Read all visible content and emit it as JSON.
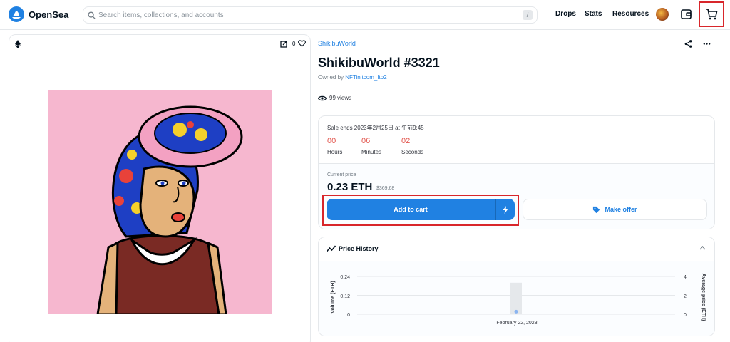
{
  "header": {
    "logo_text": "OpenSea",
    "search_placeholder": "Search items, collections, and accounts",
    "search_shortcut": "/",
    "nav": [
      "Drops",
      "Stats",
      "Resources"
    ]
  },
  "image_panel": {
    "chain_icon": "ethereum-icon",
    "favorite_count": "0"
  },
  "item": {
    "collection": "ShikibuWorld",
    "title": "ShikibuWorld #3321",
    "owned_by_label": "Owned by",
    "owner": "NFTinitcom_Ito2",
    "views": "99 views"
  },
  "sale": {
    "ends_text": "Sale ends 2023年2月25日 at 午前9:45",
    "countdown": [
      {
        "value": "00",
        "label": "Hours"
      },
      {
        "value": "06",
        "label": "Minutes"
      },
      {
        "value": "02",
        "label": "Seconds"
      }
    ],
    "current_price_label": "Current price",
    "price_eth": "0.23 ETH",
    "price_usd": "$369.68",
    "add_to_cart_label": "Add to cart",
    "make_offer_label": "Make offer"
  },
  "price_history": {
    "title": "Price History",
    "left_axis_label": "Volume (ETH)",
    "right_axis_label": "Average price (ETH)",
    "left_ticks": [
      "0.24",
      "0.12",
      "0"
    ],
    "right_ticks": [
      "4",
      "2",
      "0"
    ]
  },
  "chart_data": {
    "type": "bar",
    "title": "Price History",
    "categories": [
      "February 22, 2023"
    ],
    "series": [
      {
        "name": "Volume (ETH)",
        "values": [
          0.2
        ]
      },
      {
        "name": "Average price (ETH)",
        "values": [
          0.2
        ]
      }
    ],
    "ylabel": "Volume (ETH)",
    "y2label": "Average price (ETH)",
    "ylim": [
      0,
      0.24
    ],
    "y2lim": [
      0,
      4
    ],
    "grid": true
  },
  "colors": {
    "accent": "#2081e2",
    "countdown": "#e2554d",
    "highlight_box": "#d8262b",
    "art_background": "#f6b7cf"
  }
}
